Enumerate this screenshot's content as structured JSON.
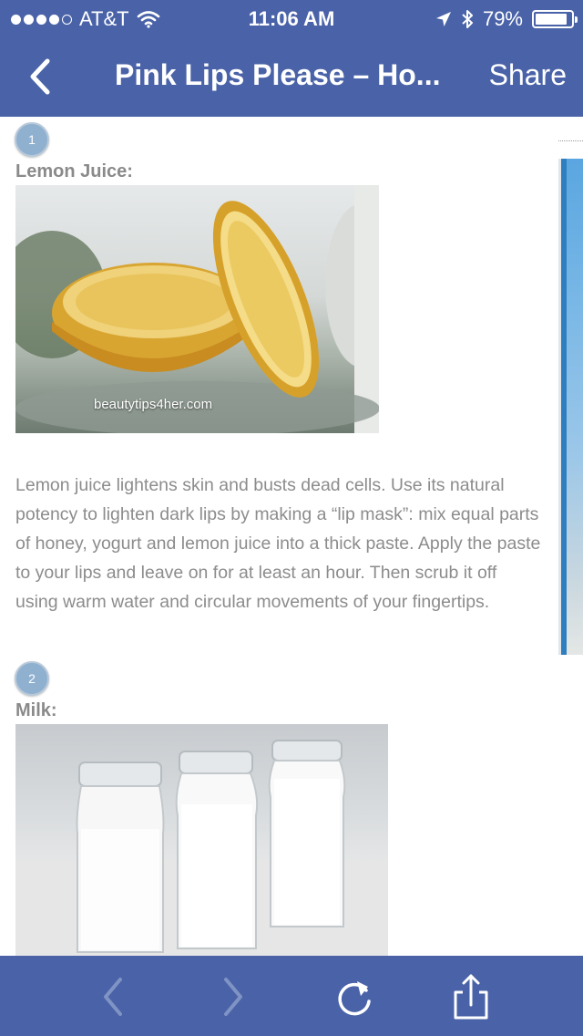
{
  "status_bar": {
    "carrier": "AT&T",
    "time": "11:06 AM",
    "battery": "79%",
    "battery_level": 0.79,
    "signal_bars": 4
  },
  "nav": {
    "title": "Pink Lips Please – Ho...",
    "share_label": "Share",
    "back_icon": "chevron-left-icon"
  },
  "steps": [
    {
      "number": "1",
      "heading": "Lemon Juice:",
      "image_watermark": "beautytips4her.com",
      "text": "Lemon juice lightens skin and busts dead cells. Use its natural potency to lighten dark lips by making a “lip mask”: mix equal parts of honey, yogurt and lemon juice into a thick paste. Apply the paste to your lips and leave on for at least an hour. Then scrub it off using warm water and circular movements of your fingertips."
    },
    {
      "number": "2",
      "heading": "Milk:"
    }
  ],
  "toolbar": {
    "icons": [
      "back-arrow-icon",
      "forward-arrow-icon",
      "reload-icon",
      "share-icon"
    ]
  },
  "colors": {
    "bar": "#4a63a8",
    "badge": "#8fb0cf",
    "text": "#8c8c8c"
  }
}
